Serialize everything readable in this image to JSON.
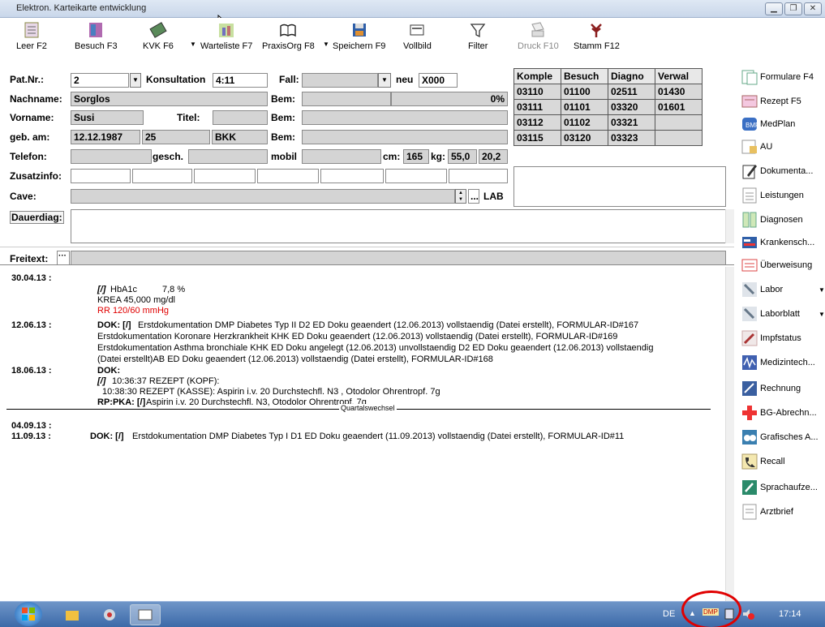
{
  "window": {
    "title": "Elektron. Karteikarte entwicklung"
  },
  "toolbar": {
    "leer": "Leer F2",
    "besuch": "Besuch F3",
    "kvk": "KVK F6",
    "warteliste": "Warteliste F7",
    "praxisorg": "PraxisOrg F8",
    "speichern": "Speichern F9",
    "vollbild": "Vollbild",
    "filter": "Filter",
    "druck": "Druck F10",
    "stamm": "Stamm F12"
  },
  "patient": {
    "patnr_label": "Pat.Nr.:",
    "patnr": "2",
    "konsultation_label": "Konsultation",
    "konsultation": "4:11",
    "fall_label": "Fall:",
    "fall": "",
    "neu_label": "neu",
    "neu_value": "X000",
    "nachname_label": "Nachname:",
    "nachname": "Sorglos",
    "bem1_label": "Bem:",
    "bem1_pct": "0%",
    "vorname_label": "Vorname:",
    "vorname": "Susi",
    "titel_label": "Titel:",
    "bem2_label": "Bem:",
    "gebam_label": "geb. am:",
    "gebam": "12.12.1987",
    "alter": "25",
    "kasse": "BKK",
    "bem3_label": "Bem:",
    "telefon_label": "Telefon:",
    "gesch_label": "gesch.",
    "mobil_label": "mobil",
    "cm_label": "cm:",
    "cm": "165",
    "kg_label": "kg:",
    "kg": "55,0",
    "bmi": "20,2",
    "zusatzinfo_label": "Zusatzinfo:",
    "cave_label": "Cave:",
    "lab_button": "LAB",
    "dots_button": "...",
    "dauerdiag_label": "Dauerdiag:",
    "freitext_label": "Freitext:"
  },
  "grid": {
    "headers": [
      "Komple",
      "Besuch",
      "Diagno",
      "Verwal"
    ],
    "rows": [
      [
        "03110",
        "01100",
        "02511",
        "01430"
      ],
      [
        "03111",
        "01101",
        "03320",
        "01601"
      ],
      [
        "03112",
        "01102",
        "03321",
        ""
      ],
      [
        "03115",
        "03120",
        "03323",
        ""
      ]
    ]
  },
  "sidebar": {
    "items": [
      "Formulare F4",
      "Rezept F5",
      "MedPlan",
      "AU",
      "Dokumenta...",
      "Leistungen",
      "Diagnosen",
      "Krankensch...",
      "Überweisung",
      "Labor",
      "Laborblatt",
      "Impfstatus",
      "Medizintech...",
      "Rechnung",
      "BG-Abrechn...",
      "Grafisches A...",
      "Recall",
      "Sprachaufze...",
      "Arztbrief"
    ]
  },
  "log": {
    "d1": "30.04.13 :",
    "e1a_tag": "[/]",
    "e1a_name": "HbA1c",
    "e1a_val": "7,8 %",
    "e1b": "KREA   45,000 mg/dl",
    "e1c": "RR 120/60 mmHg",
    "d2": "12.06.13 :",
    "e2a_tag": "DOK: [/]",
    "e2a": "Erstdokumentation DMP Diabetes Typ II D2 ED Doku geaendert (12.06.2013) vollstaendig  (Datei erstellt), FORMULAR-ID#167",
    "e2b": "Erstdokumentation Koronare Herzkrankheit KHK ED Doku geaendert (12.06.2013) vollstaendig  (Datei erstellt), FORMULAR-ID#169",
    "e2c": "Erstdokumentation Asthma bronchiale KHK ED Doku angelegt (12.06.2013) unvollstaendig D2 ED Doku geaendert (12.06.2013) vollstaendig",
    "e2d": "(Datei erstellt)AB ED Doku geaendert (12.06.2013) vollstaendig  (Datei erstellt), FORMULAR-ID#168",
    "d3": "18.06.13 :",
    "e3a": "DOK:",
    "e3b_tag": "[/]",
    "e3b": "10:36:37  REZEPT (KOPF):",
    "e3c": "10:38:30  REZEPT (KASSE): Aspirin i.v. 20 Durchstechfl. N3 , Otodolor Ohrentropf. 7g",
    "e3d_tag": "RP:PKA: [/]",
    "e3d": "Aspirin i.v. 20 Durchstechfl. N3, Otodolor Ohrentropf. 7g",
    "quartal": "Quartalswechsel",
    "d4": "04.09.13 :",
    "d5": "11.09.13 :",
    "e5_tag": "DOK: [/]",
    "e5": "Erstdokumentation DMP Diabetes Typ I D1 ED Doku geaendert (11.09.2013) vollstaendig  (Datei erstellt), FORMULAR-ID#11"
  },
  "taskbar": {
    "lang": "DE",
    "time": "17:14",
    "dmp": "DMP"
  },
  "colors": {
    "rr_red": "#e00000",
    "ring_red": "#e00000"
  }
}
